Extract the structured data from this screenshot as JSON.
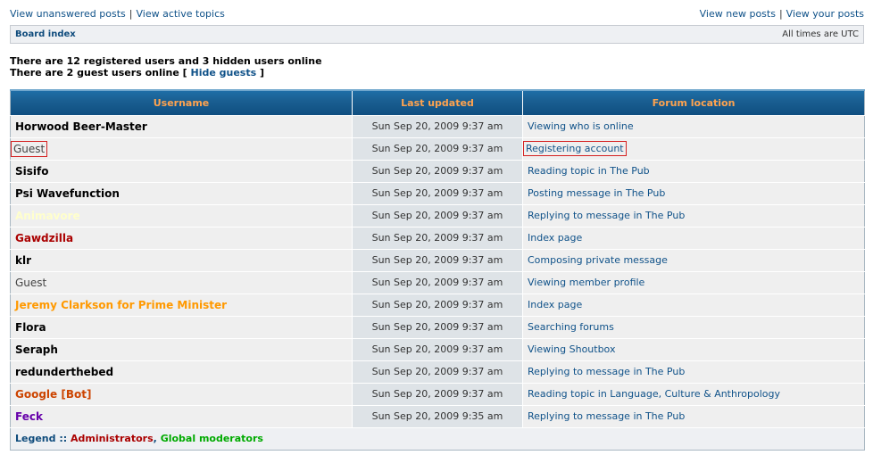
{
  "topnav": {
    "unanswered": "View unanswered posts",
    "active": "View active topics",
    "new_posts": "View new posts",
    "your_posts": "View your posts",
    "separator": "|"
  },
  "navbar": {
    "board_index": "Board index",
    "timezone": "All times are UTC"
  },
  "online": {
    "registered_line": "There are 12 registered users and 3 hidden users online",
    "guest_line_prefix": "There are 2 guest users online [",
    "hide_guests": "Hide guests",
    "guest_line_suffix": "]"
  },
  "table": {
    "headers": [
      "Username",
      "Last updated",
      "Forum location"
    ],
    "rows": [
      {
        "username": "Horwood Beer-Master",
        "color": "#000000",
        "guest": false,
        "updated": "Sun Sep 20, 2009 9:37 am",
        "location": "Viewing who is online",
        "highlight": false
      },
      {
        "username": "Guest",
        "color": "#444444",
        "guest": true,
        "updated": "Sun Sep 20, 2009 9:37 am",
        "location": "Registering account",
        "highlight": true
      },
      {
        "username": "Sisifo",
        "color": "#000000",
        "guest": false,
        "updated": "Sun Sep 20, 2009 9:37 am",
        "location": "Reading topic in The Pub",
        "highlight": false
      },
      {
        "username": "Psi Wavefunction",
        "color": "#000000",
        "guest": false,
        "updated": "Sun Sep 20, 2009 9:37 am",
        "location": "Posting message in The Pub",
        "highlight": false
      },
      {
        "username": "Animavore",
        "color": "#ffffcc",
        "guest": false,
        "updated": "Sun Sep 20, 2009 9:37 am",
        "location": "Replying to message in The Pub",
        "highlight": false
      },
      {
        "username": "Gawdzilla",
        "color": "#aa0000",
        "guest": false,
        "updated": "Sun Sep 20, 2009 9:37 am",
        "location": "Index page",
        "highlight": false
      },
      {
        "username": "klr",
        "color": "#000000",
        "guest": false,
        "updated": "Sun Sep 20, 2009 9:37 am",
        "location": "Composing private message",
        "highlight": false
      },
      {
        "username": "Guest",
        "color": "#444444",
        "guest": true,
        "updated": "Sun Sep 20, 2009 9:37 am",
        "location": "Viewing member profile",
        "highlight": false
      },
      {
        "username": "Jeremy Clarkson for Prime Minister",
        "color": "#ff9900",
        "guest": false,
        "updated": "Sun Sep 20, 2009 9:37 am",
        "location": "Index page",
        "highlight": false
      },
      {
        "username": "Flora",
        "color": "#000000",
        "guest": false,
        "updated": "Sun Sep 20, 2009 9:37 am",
        "location": "Searching forums",
        "highlight": false
      },
      {
        "username": "Seraph",
        "color": "#000000",
        "guest": false,
        "updated": "Sun Sep 20, 2009 9:37 am",
        "location": "Viewing Shoutbox",
        "highlight": false
      },
      {
        "username": "redunderthebed",
        "color": "#000000",
        "guest": false,
        "updated": "Sun Sep 20, 2009 9:37 am",
        "location": "Replying to message in The Pub",
        "highlight": false
      },
      {
        "username": "Google [Bot]",
        "color": "#cc4400",
        "guest": false,
        "updated": "Sun Sep 20, 2009 9:37 am",
        "location": "Reading topic in Language, Culture & Anthropology",
        "highlight": false
      },
      {
        "username": "Feck",
        "color": "#6600aa",
        "guest": false,
        "updated": "Sun Sep 20, 2009 9:35 am",
        "location": "Replying to message in The Pub",
        "highlight": false
      }
    ]
  },
  "legend": {
    "label": "Legend ::",
    "admins": "Administrators",
    "comma": ",",
    "gmods": "Global moderators"
  },
  "colors": {
    "link": "#105289",
    "header_text": "#ffa34f",
    "admin": "#aa0000",
    "gmod": "#00aa00"
  }
}
